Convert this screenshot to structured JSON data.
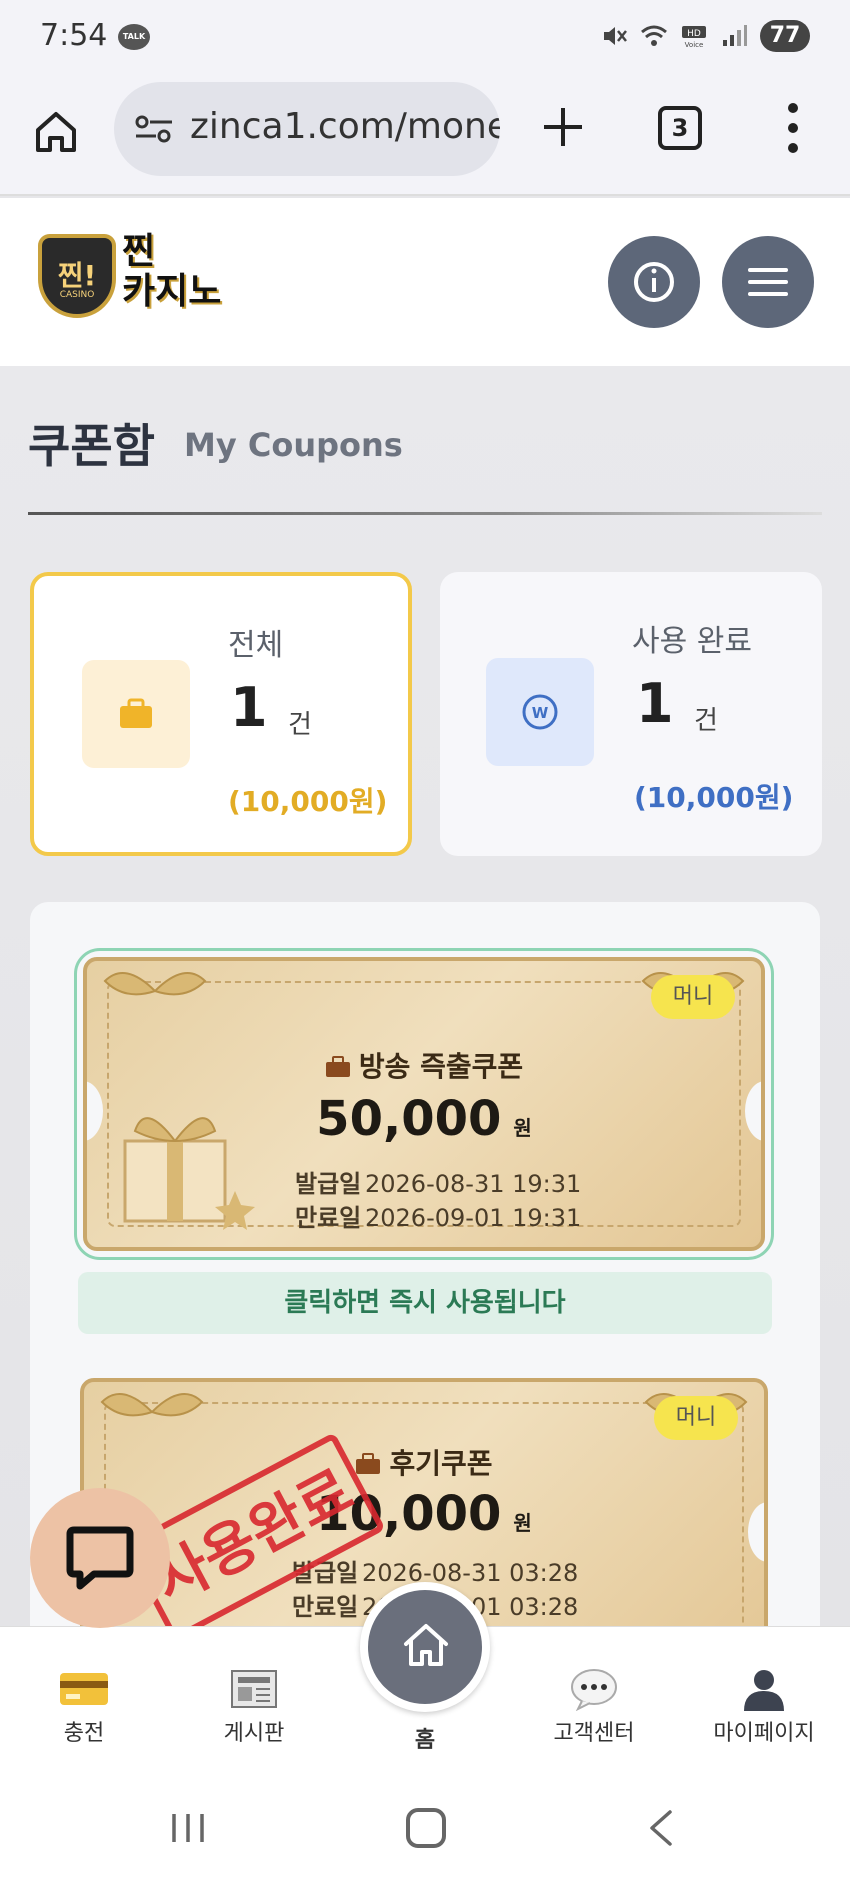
{
  "status_bar": {
    "time": "7:54",
    "talk_badge": "TALK",
    "battery": "77",
    "hd_label": "HD Voice"
  },
  "browser": {
    "url": "zinca1.com/mone",
    "tab_count": "3"
  },
  "header": {
    "logo_badge_text": "찐!",
    "logo_badge_sub": "CASINO",
    "logo_text_line1": "찐",
    "logo_text_line2": "카지노"
  },
  "page": {
    "title": "쿠폰함",
    "subtitle": "My Coupons"
  },
  "stats": {
    "total": {
      "label": "전체",
      "count": "1",
      "unit": "건",
      "amount": "(10,000원)"
    },
    "used": {
      "label": "사용 완료",
      "count": "1",
      "unit": "건",
      "amount": "(10,000원)",
      "icon_letter": "W"
    }
  },
  "coupons": [
    {
      "badge": "머니",
      "name": "방송 즉출쿠폰",
      "amount": "50,000",
      "currency": "원",
      "issued_label": "발급일",
      "issued": "2026-08-31 19:31",
      "expires_label": "만료일",
      "expires": "2026-09-01 19:31",
      "hint": "클릭하면 즉시 사용됩니다"
    },
    {
      "badge": "머니",
      "name": "후기쿠폰",
      "amount": "10,000",
      "currency": "원",
      "issued_label": "발급일",
      "issued": "2026-08-31 03:28",
      "expires_label": "만료일",
      "expires": "2026-09-01 03:28",
      "stamp": "사용완료"
    }
  ],
  "bottom_nav": {
    "items": [
      "충전",
      "게시판",
      "홈",
      "고객센터",
      "마이페이지"
    ]
  },
  "colors": {
    "accent_yellow": "#f3c94a",
    "accent_blue": "#3f6fc4",
    "hint_green": "#2b7a55",
    "stamp_red": "#d8282f",
    "header_button": "#5d6779"
  }
}
